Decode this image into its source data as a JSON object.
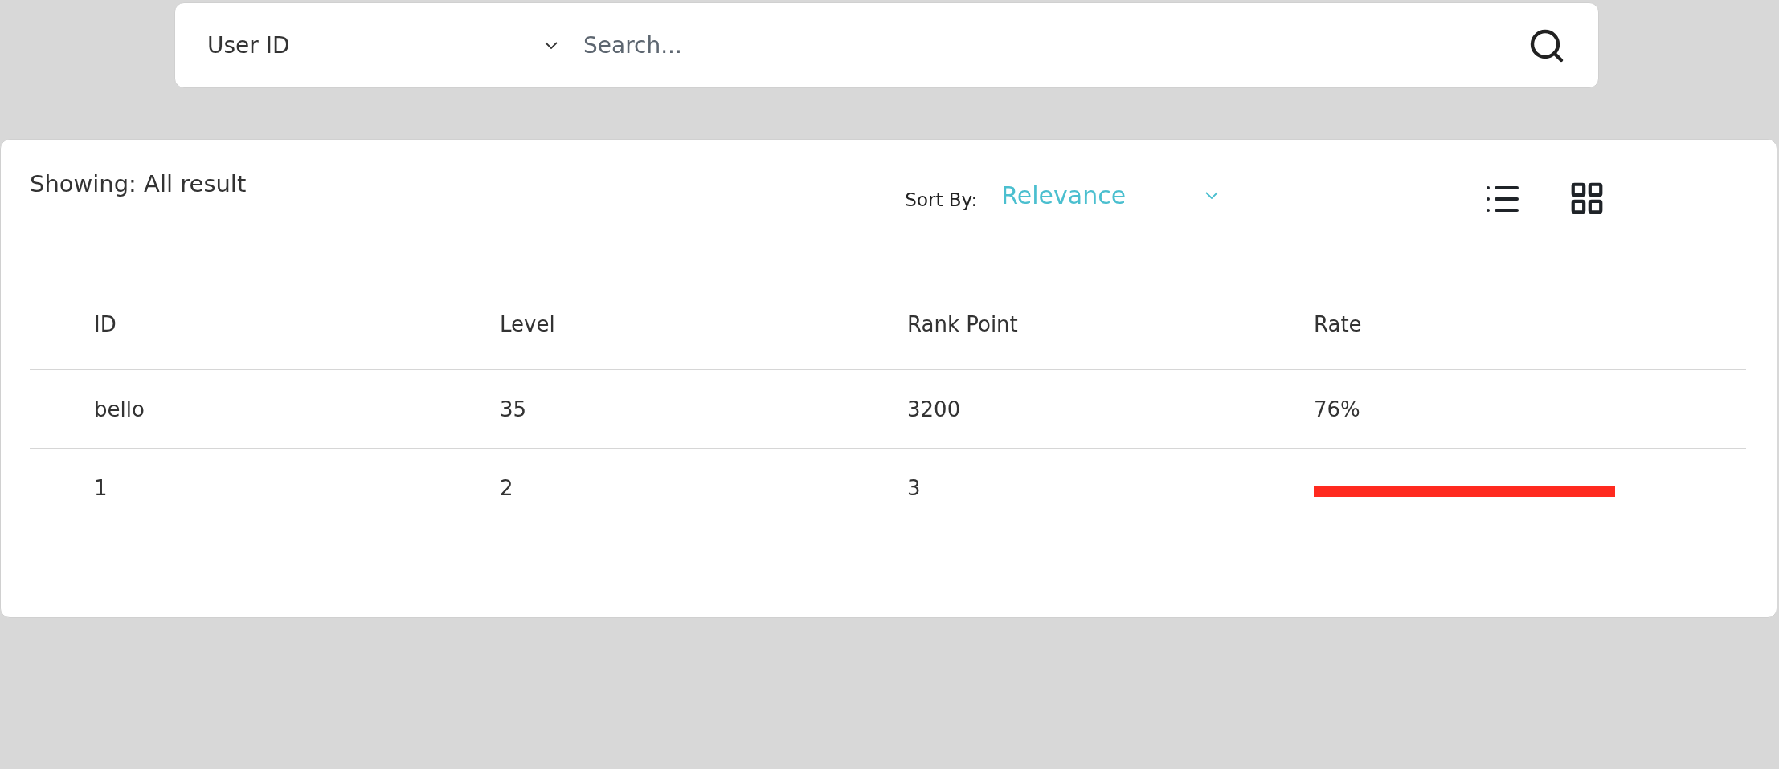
{
  "search_bar": {
    "field_selector": "User ID",
    "placeholder": "Search..."
  },
  "results": {
    "showing": "Showing: All result",
    "sort_label": "Sort By:",
    "sort_value": "Relevance",
    "table": {
      "columns": [
        "ID",
        "Level",
        "Rank Point",
        "Rate"
      ],
      "rows": [
        {
          "cells": [
            "bello",
            "35",
            "3200",
            "76%"
          ],
          "redacted": false
        },
        {
          "cells": [
            "1",
            "2",
            "3"
          ],
          "redacted": true
        }
      ]
    }
  }
}
